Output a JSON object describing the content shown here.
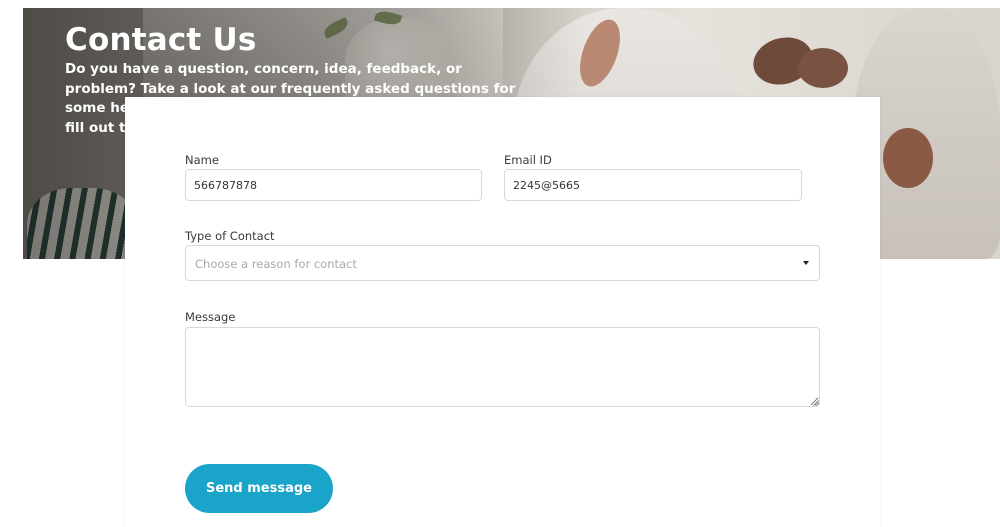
{
  "hero": {
    "title": "Contact Us",
    "text": "Do you have a question, concern, idea, feedback, or problem? Take a look at our frequently asked questions for some helpful information, and if you still need help, please fill out the form below and we'll be happy to help!"
  },
  "form": {
    "name": {
      "label": "Name",
      "value": "566787878"
    },
    "email": {
      "label": "Email ID",
      "value": "2245@5665"
    },
    "contact_type": {
      "label": "Type of Contact",
      "placeholder": "Choose a reason for contact"
    },
    "message": {
      "label": "Message",
      "value": ""
    },
    "submit_label": "Send message"
  },
  "colors": {
    "accent": "#1aa4c9",
    "input_border": "#d9d9d9",
    "placeholder": "#a9a9a9"
  },
  "icons": {
    "select_caret": "caret-down-icon",
    "textarea_resize": "resize-grip-icon"
  }
}
